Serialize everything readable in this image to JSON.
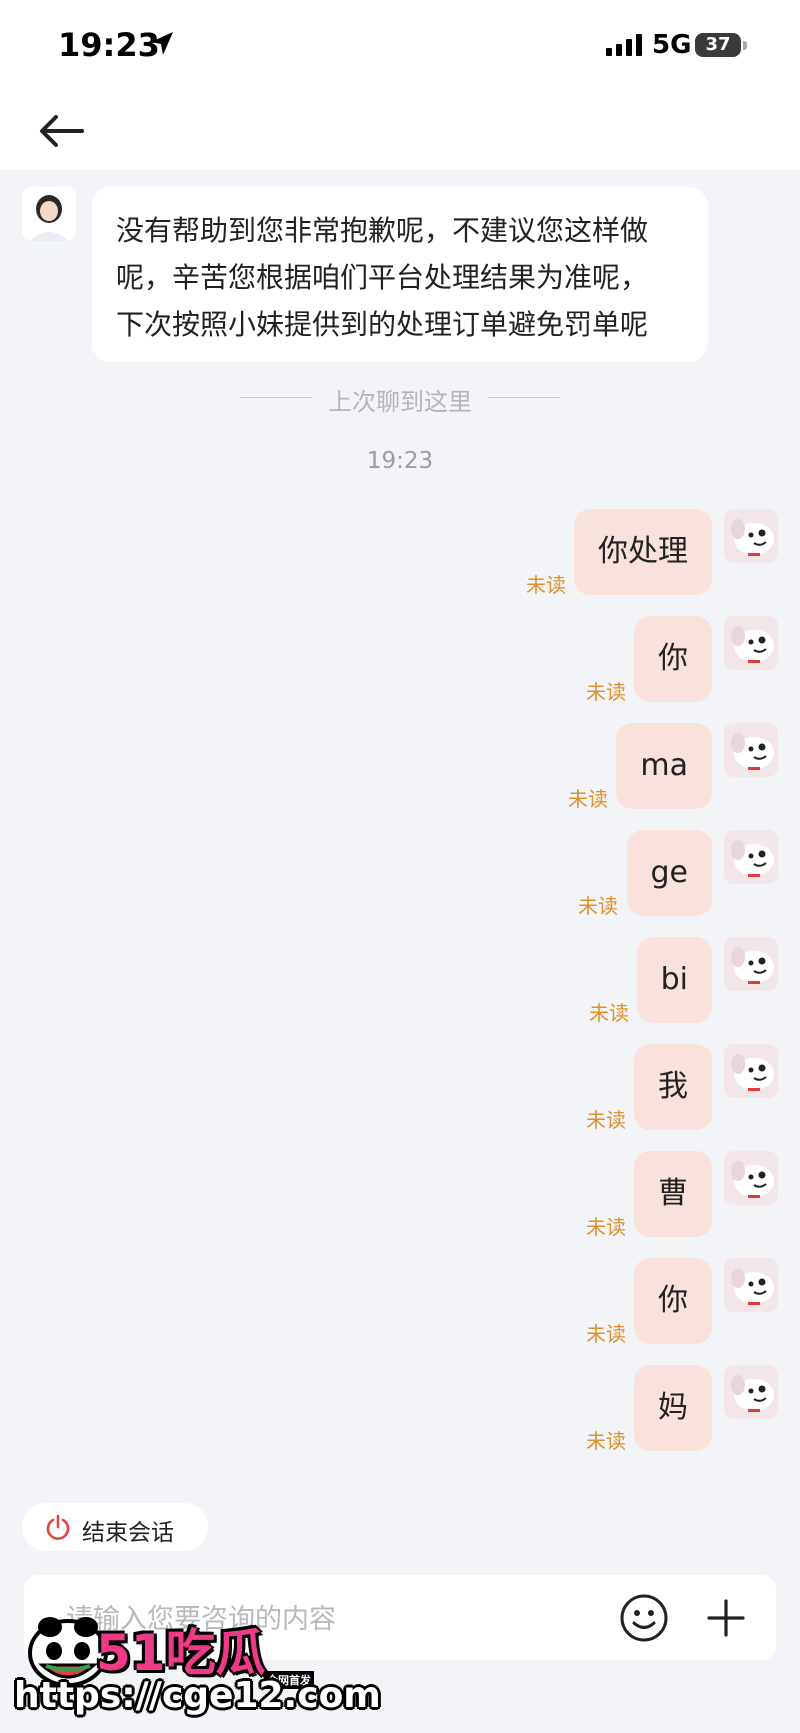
{
  "status_bar": {
    "time": "19:23",
    "network": "5G",
    "battery": "37"
  },
  "agent_message": {
    "lines": [
      "没有帮助到您非常抱歉呢，不建议您这样做",
      "呢，辛苦您根据咱们平台处理结果为准呢，",
      "下次按照小妹提供到的处理订单避免罚单呢"
    ]
  },
  "divider_text": "上次聊到这里",
  "timestamp": "19:23",
  "messages": [
    {
      "text": "你处理",
      "status": "未读"
    },
    {
      "text": "你",
      "status": "未读"
    },
    {
      "text": "ma",
      "status": "未读"
    },
    {
      "text": "ge",
      "status": "未读"
    },
    {
      "text": "bi",
      "status": "未读"
    },
    {
      "text": "我",
      "status": "未读"
    },
    {
      "text": "曹",
      "status": "未读"
    },
    {
      "text": "你",
      "status": "未读"
    },
    {
      "text": "妈",
      "status": "未读"
    }
  ],
  "end_session": {
    "label": "结束会话"
  },
  "input": {
    "placeholder": "请输入您要咨询的内容"
  },
  "watermark": {
    "brand": "51吃瓜",
    "tag": "全网首发",
    "url": "https://cge12.com"
  },
  "colors": {
    "user_bubble": "#f9e2dc",
    "unread": "#e0902a",
    "end_icon": "#e0473b"
  }
}
